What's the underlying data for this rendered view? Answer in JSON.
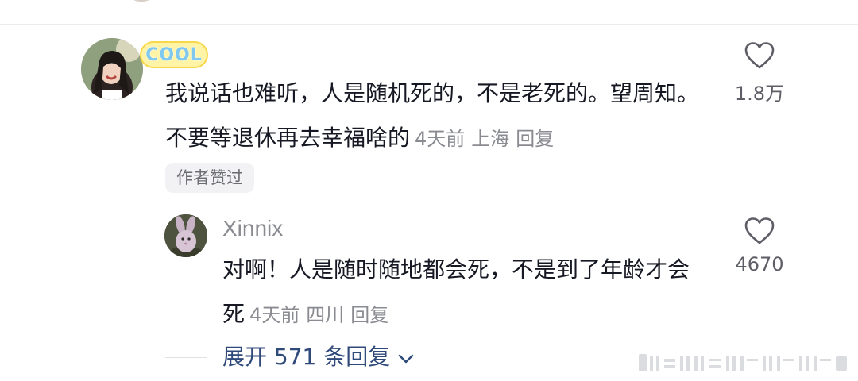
{
  "comment": {
    "badge": "COOL",
    "text": "我说话也难听，人是随机死的，不是老死的。望周知。不要等退休再去幸福啥的",
    "time": "4天前",
    "location": "上海",
    "reply_label": "回复",
    "like_count": "1.8万",
    "author_liked": "作者赞过"
  },
  "reply": {
    "username": "Xinnix",
    "text": "对啊！人是随时随地都会死，不是到了年龄才会死",
    "time": "4天前",
    "location": "四川",
    "reply_label": "回复",
    "like_count": "4670"
  },
  "expand": {
    "label": "展开 571 条回复"
  },
  "icons": {
    "like": "heart-outline-icon",
    "expand": "chevron-down-icon"
  },
  "colors": {
    "text": "#161823",
    "meta": "#8a8b91",
    "link": "#2f4a7a",
    "badge": "#fff3a6"
  }
}
